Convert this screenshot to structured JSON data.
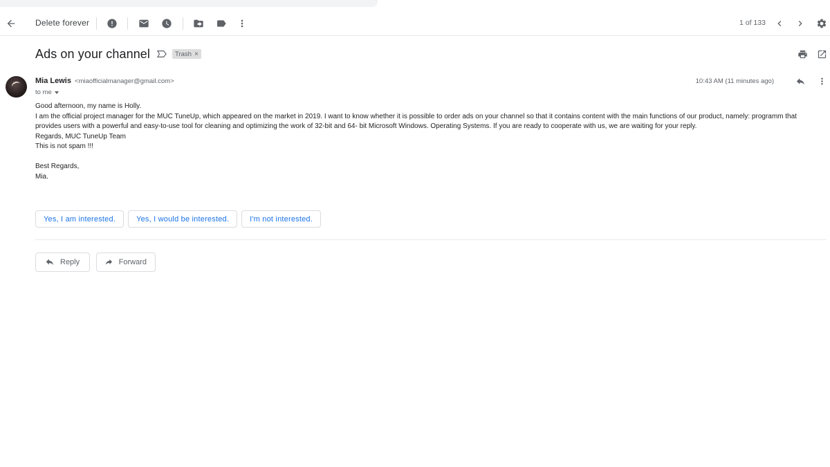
{
  "toolbar": {
    "back_icon": "arrow-left-icon",
    "delete_forever_label": "Delete forever",
    "report_spam_icon": "exclamation-icon",
    "mark_unread_icon": "envelope-icon",
    "snooze_icon": "clock-icon",
    "move_to_icon": "folder-arrow-icon",
    "labels_icon": "label-icon",
    "more_icon": "more-vertical-icon",
    "pager_text": "1 of 133",
    "newer_icon": "chevron-left-icon",
    "older_icon": "chevron-right-icon",
    "settings_icon": "gear-icon"
  },
  "email": {
    "subject": "Ads on your channel",
    "label_chip": "Trash",
    "label_chip_close": "×",
    "sender_name": "Mia Lewis",
    "sender_email": "<miaofficialmanager@gmail.com>",
    "recipient": "to me",
    "timestamp": "10:43 AM (11 minutes ago)",
    "body": {
      "line1": "Good afternoon, my name is Holly.",
      "line2": "I am the official project manager for the MUC TuneUp, which appeared on the market in 2019. I want to know whether it is possible to order ads on your channel so that it contains content with the main functions of our product, namely: programm that provides users with a powerful and easy-to-use tool for cleaning and optimizing the work of 32-bit and 64- bit Microsoft Windows. Operating Systems. If you are ready to cooperate with us, we are waiting for your reply.",
      "line3": "Regards, MUC TuneUp Team",
      "line4": "This is not spam !!!",
      "line5": "Best Regards,",
      "line6": "Mia."
    }
  },
  "smart_replies": [
    "Yes, I am interested.",
    "Yes, I would be interested.",
    "I'm not interested."
  ],
  "actions": {
    "reply_label": "Reply",
    "forward_label": "Forward"
  },
  "colors": {
    "accent_blue": "#1a73e8",
    "icon_gray": "#5f6368",
    "text": "#202124",
    "border": "#dadce0"
  }
}
